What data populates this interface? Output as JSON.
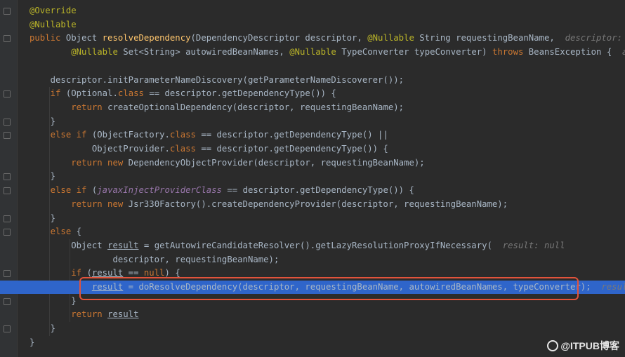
{
  "lines": [
    [
      [
        "ann",
        "@Override"
      ]
    ],
    [
      [
        "ann",
        "@Nullable"
      ]
    ],
    [
      [
        "kw",
        "public "
      ],
      [
        "",
        "Object "
      ],
      [
        "fn",
        "resolveDependency"
      ],
      [
        "",
        "(DependencyDescriptor descriptor, "
      ],
      [
        "ann",
        "@Nullable "
      ],
      [
        "",
        "String requestingBeanName,  "
      ],
      [
        "hint",
        "descriptor: \"fie"
      ]
    ],
    [
      [
        "",
        "        "
      ],
      [
        "ann",
        "@Nullable "
      ],
      [
        "",
        "Set<String> autowiredBeanNames, "
      ],
      [
        "ann",
        "@Nullable "
      ],
      [
        "",
        "TypeConverter typeConverter) "
      ],
      [
        "kw",
        "throws "
      ],
      [
        "",
        "BeansException {  "
      ],
      [
        "hint",
        "autow"
      ]
    ],
    [],
    [
      [
        "",
        "    descriptor.initParameterNameDiscovery(getParameterNameDiscoverer());"
      ]
    ],
    [
      [
        "",
        "    "
      ],
      [
        "kw",
        "if "
      ],
      [
        "",
        "(Optional."
      ],
      [
        "kw",
        "class "
      ],
      [
        "",
        "== descriptor.getDependencyType()) {"
      ]
    ],
    [
      [
        "",
        "        "
      ],
      [
        "kw",
        "return "
      ],
      [
        "",
        "createOptionalDependency(descriptor, requestingBeanName);"
      ]
    ],
    [
      [
        "",
        "    }"
      ]
    ],
    [
      [
        "",
        "    "
      ],
      [
        "kw",
        "else if "
      ],
      [
        "",
        "(ObjectFactory."
      ],
      [
        "kw",
        "class "
      ],
      [
        "",
        "== descriptor.getDependencyType() ||"
      ]
    ],
    [
      [
        "",
        "            ObjectProvider."
      ],
      [
        "kw",
        "class "
      ],
      [
        "",
        "== descriptor.getDependencyType()) {"
      ]
    ],
    [
      [
        "",
        "        "
      ],
      [
        "kw",
        "return new "
      ],
      [
        "",
        "DependencyObjectProvider(descriptor, requestingBeanName);"
      ]
    ],
    [
      [
        "",
        "    }"
      ]
    ],
    [
      [
        "",
        "    "
      ],
      [
        "kw",
        "else if "
      ],
      [
        "",
        "("
      ],
      [
        "jx",
        "javaxInjectProviderClass"
      ],
      [
        "",
        " == descriptor.getDependencyType()) {"
      ]
    ],
    [
      [
        "",
        "        "
      ],
      [
        "kw",
        "return new "
      ],
      [
        "",
        "Jsr330Factory().createDependencyProvider(descriptor, requestingBeanName);"
      ]
    ],
    [
      [
        "",
        "    }"
      ]
    ],
    [
      [
        "",
        "    "
      ],
      [
        "kw",
        "else "
      ],
      [
        "",
        "{"
      ]
    ],
    [
      [
        "",
        "        Object "
      ],
      [
        "ul",
        "result"
      ],
      [
        "",
        " = getAutowireCandidateResolver().getLazyResolutionProxyIfNecessary(  "
      ],
      [
        "hint",
        "result: null"
      ]
    ],
    [
      [
        "",
        "                descriptor, requestingBeanName);"
      ]
    ],
    [
      [
        "",
        "        "
      ],
      [
        "kw",
        "if "
      ],
      [
        "",
        "("
      ],
      [
        "ul",
        "result"
      ],
      [
        "",
        " == "
      ],
      [
        "kw",
        "null"
      ],
      [
        "",
        ") {"
      ]
    ],
    [
      [
        "",
        "            "
      ],
      [
        "ul",
        "result"
      ],
      [
        "",
        " = doResolveDependency(descriptor, requestingBeanName, autowiredBeanNames, typeConverter);  "
      ],
      [
        "hint",
        "result: n"
      ]
    ],
    [
      [
        "",
        "        }"
      ]
    ],
    [
      [
        "",
        "        "
      ],
      [
        "kw",
        "return "
      ],
      [
        "ul",
        "result"
      ],
      [
        ";"
      ]
    ],
    [
      [
        "",
        "    }"
      ]
    ],
    [
      [
        "",
        "}"
      ]
    ]
  ],
  "highlight_line": 20,
  "watermark": "@ITPUB博客"
}
